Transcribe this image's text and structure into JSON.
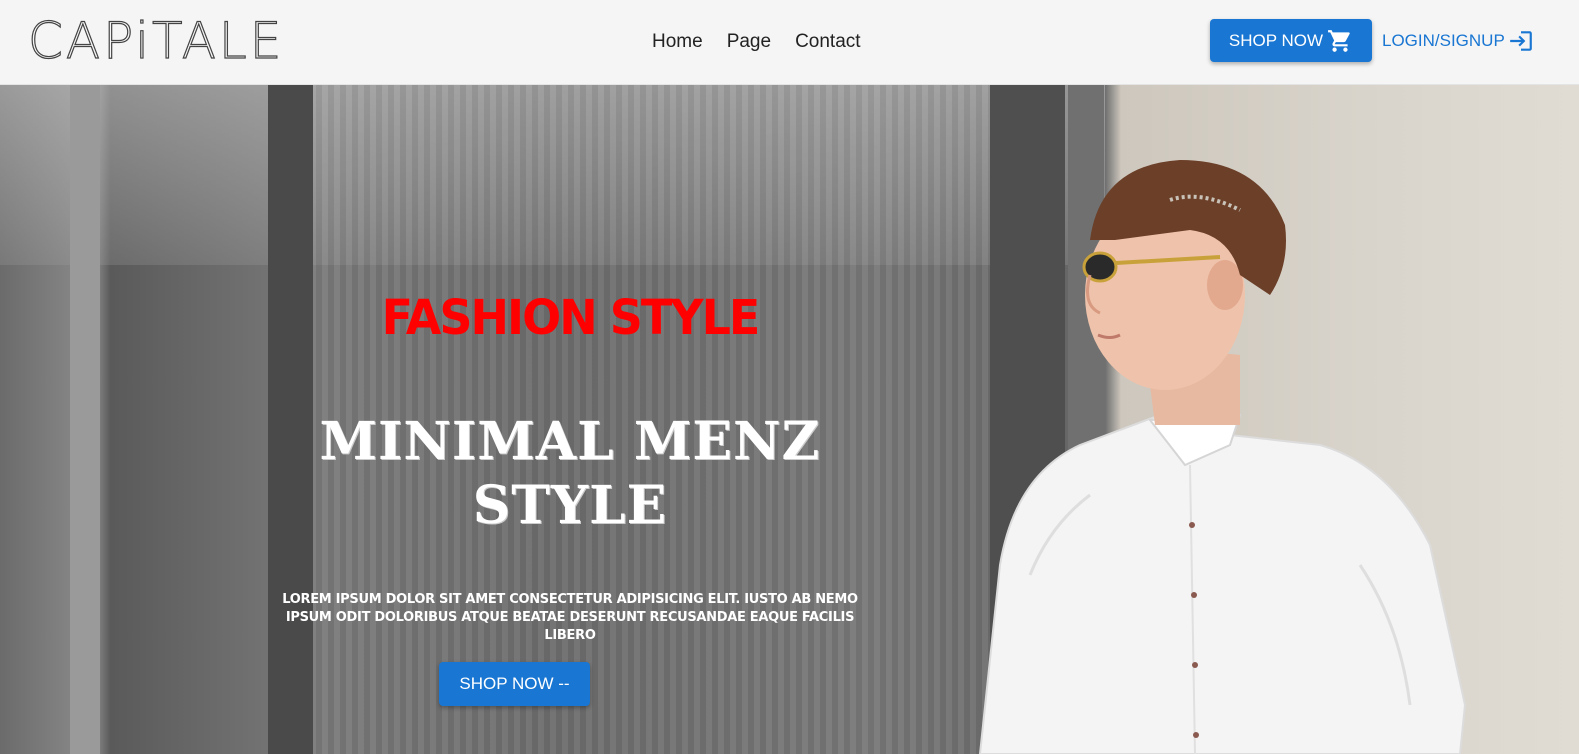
{
  "navbar": {
    "logo": "CAPiTALE",
    "links": [
      "Home",
      "Page",
      "Contact"
    ],
    "shop_button": "SHOP NOW",
    "login_button": "LOGIN/SIGNUP"
  },
  "hero": {
    "tagline": "FASHION STYLE",
    "headline_line1": "MINIMAL MENZ",
    "headline_line2": "STYLE",
    "description": "LOREM IPSUM DOLOR SIT AMET CONSECTETUR ADIPISICING ELIT. IUSTO AB NEMO IPSUM ODIT DOLORIBUS ATQUE BEATAE DESERUNT RECUSANDAE EAQUE FACILIS LIBERO",
    "cta_button": "SHOP NOW --"
  },
  "colors": {
    "primary": "#1976d2",
    "tagline": "#ff0000"
  },
  "icons": {
    "cart": "shopping-cart-icon",
    "login": "login-icon"
  }
}
